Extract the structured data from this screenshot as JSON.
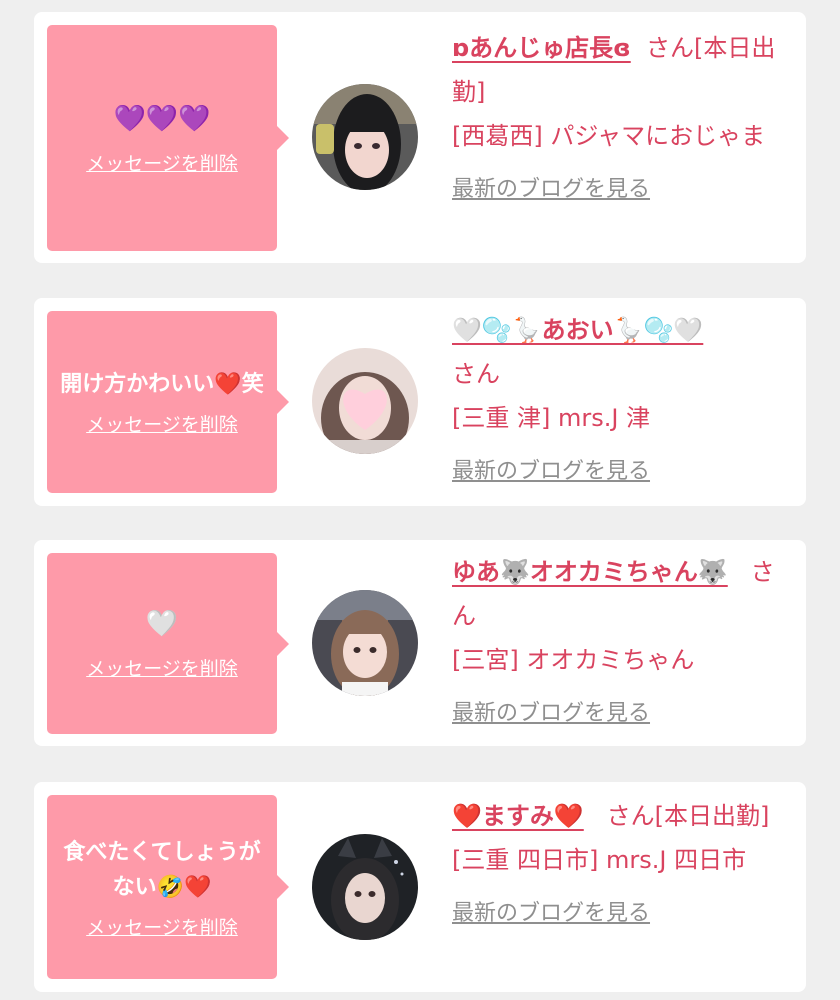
{
  "colors": {
    "background": "#efefef",
    "card": "#ffffff",
    "bubble": "#fe9aa9",
    "accent": "#d9435f",
    "link_gray": "#8f8f8f"
  },
  "common": {
    "delete_label": "メッセージを削除",
    "blog_label": "最新のブログを見る",
    "san": "さん"
  },
  "messages": [
    {
      "text": "💜💜💜",
      "name": "ɒあんじゅ店長ɞ",
      "status": "[本日出勤]",
      "shop": "[西葛西] パジャマにおじゃま",
      "avatar_icon": "avatar-photo"
    },
    {
      "text": "開け方かわいい❤️笑",
      "name": "🤍🫧🪿あおい🪿🫧🤍",
      "status": "",
      "shop": "[三重 津] mrs.J 津",
      "avatar_icon": "avatar-heart-sticker"
    },
    {
      "text": "🤍",
      "name": "ゆあ🐺オオカミちゃん🐺",
      "status": "",
      "shop": "[三宮] オオカミちゃん",
      "avatar_icon": "avatar-photo"
    },
    {
      "text": "食べたくてしょうがない🤣❤️",
      "name": "❤️ますみ❤️",
      "status": "[本日出勤]",
      "shop": "[三重 四日市] mrs.J 四日市",
      "avatar_icon": "avatar-photo"
    }
  ]
}
